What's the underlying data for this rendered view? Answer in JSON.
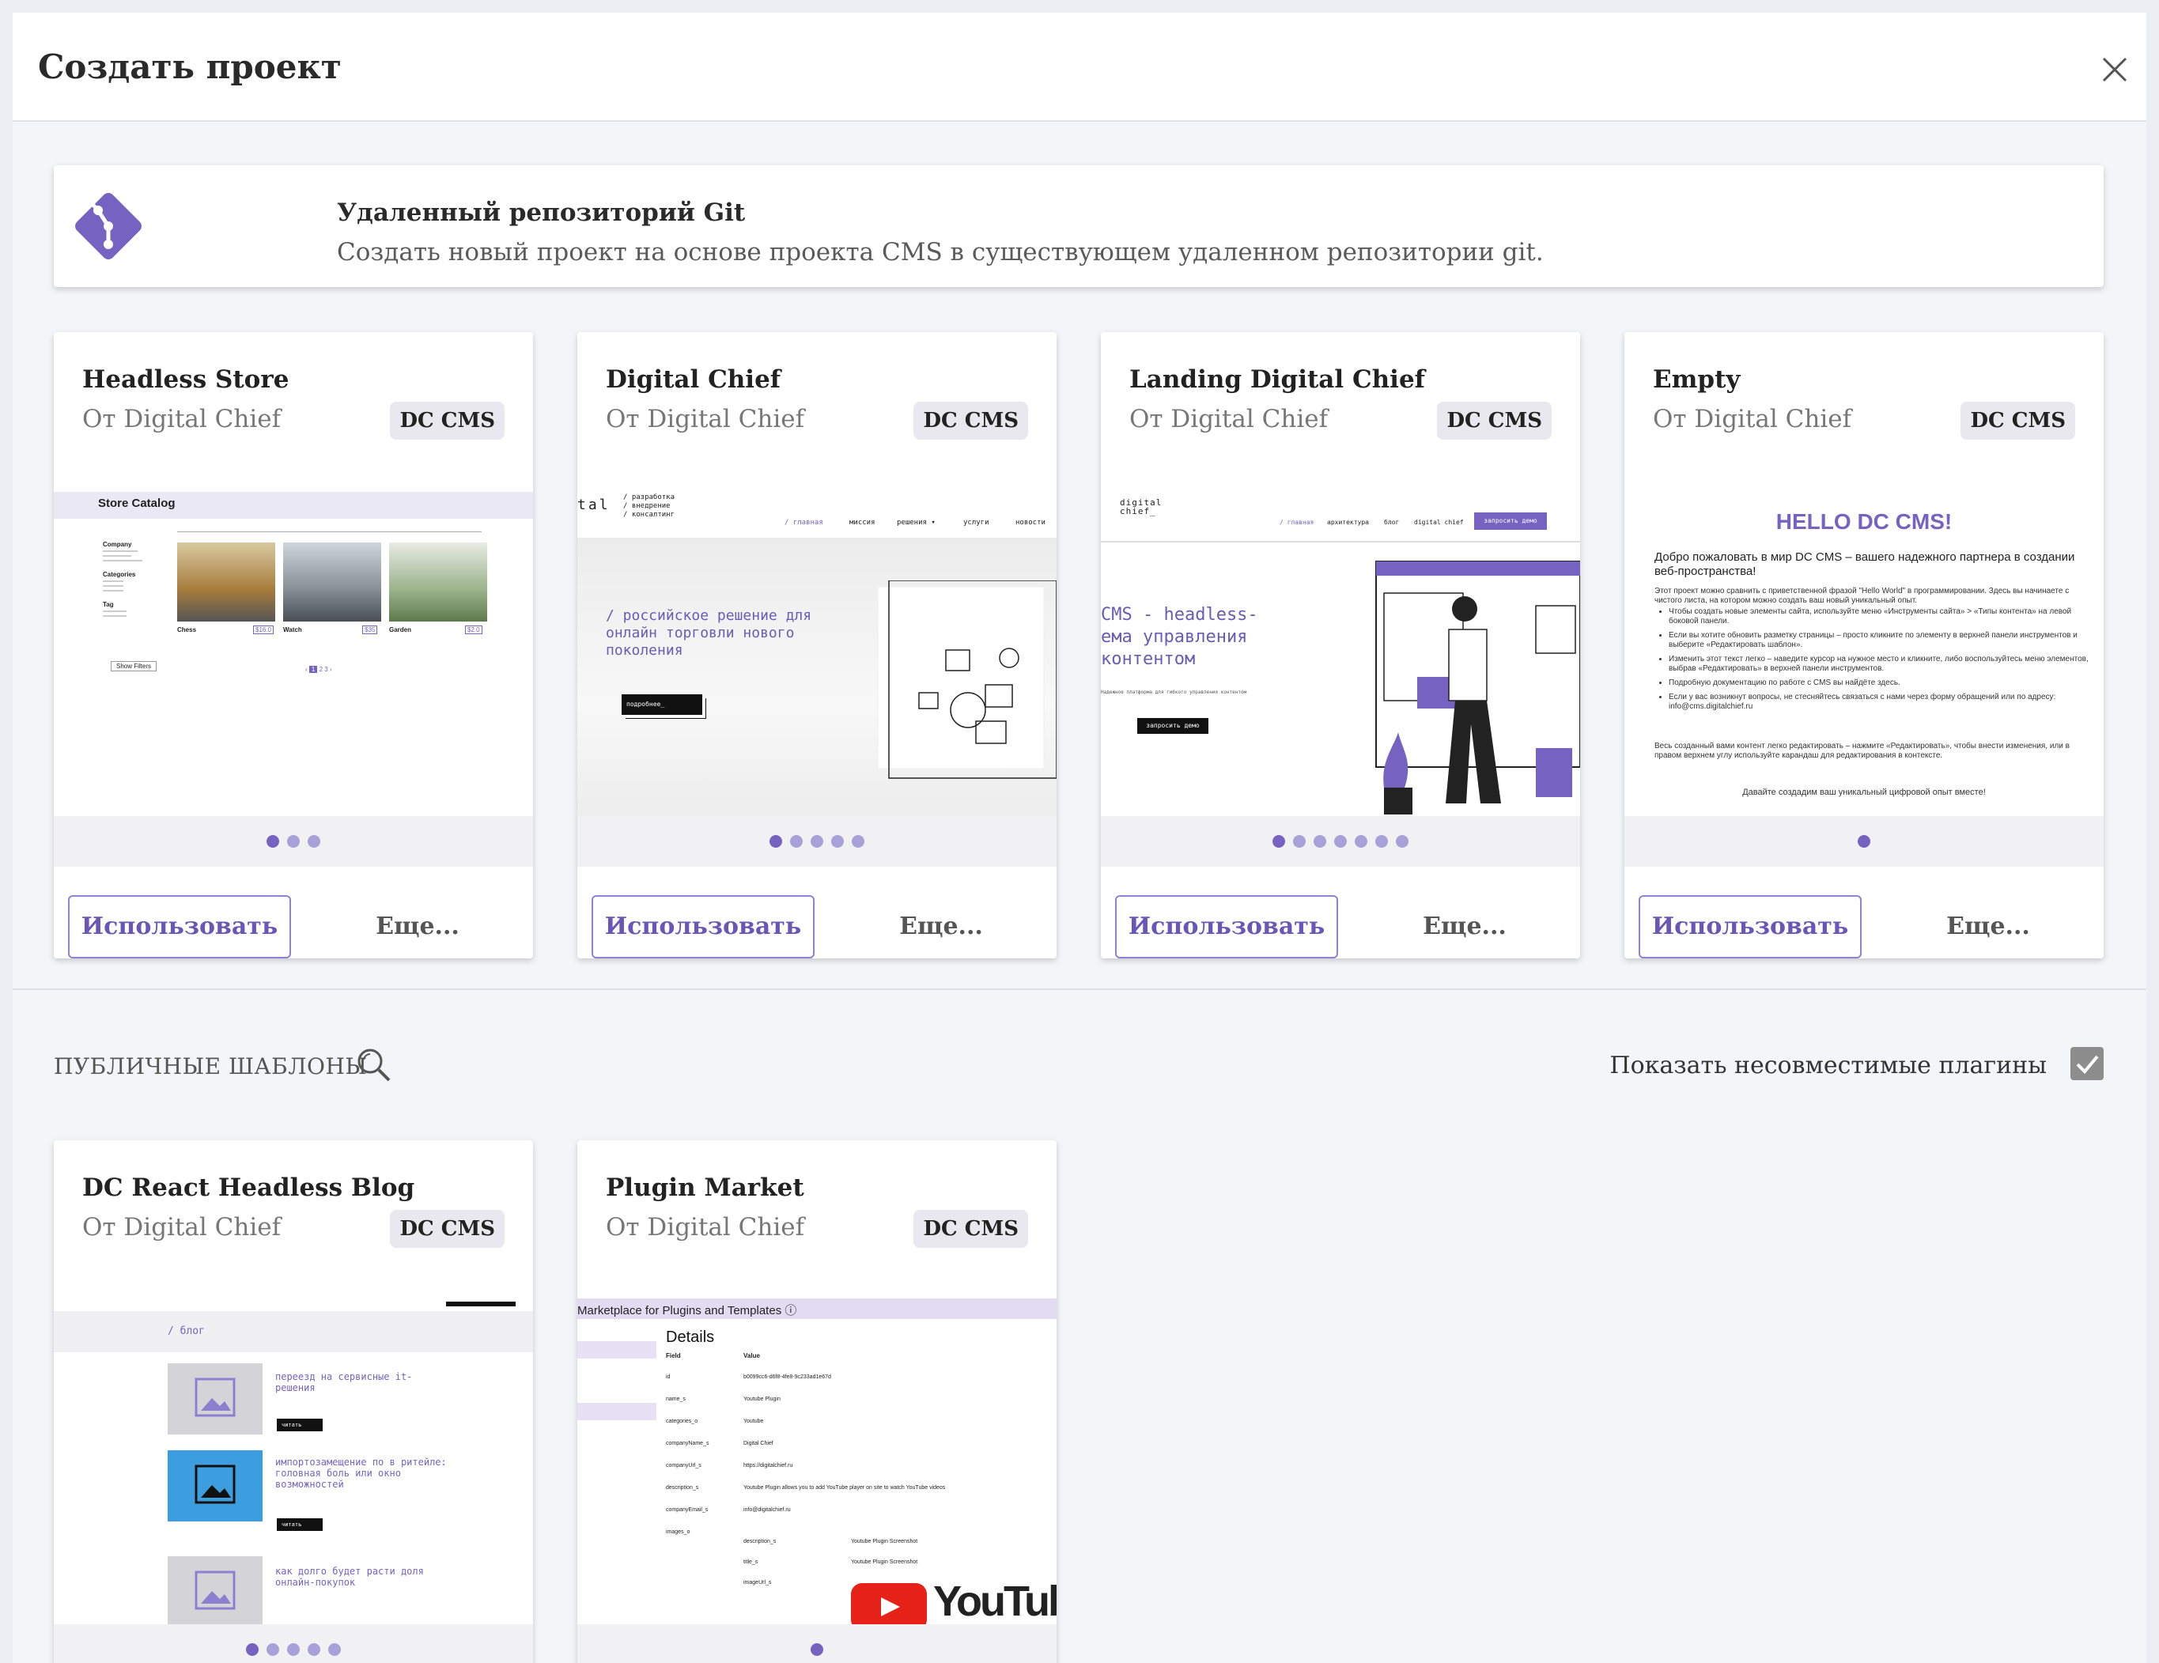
{
  "dialog": {
    "title": "Создать проект"
  },
  "git_option": {
    "title": "Удаленный репозиторий Git",
    "description": "Создать новый проект на основе проекта CMS в существующем удаленном репозитории git."
  },
  "common": {
    "use_label": "Использовать",
    "more_label": "Еще...",
    "badge": "DC CMS",
    "author": "От Digital Chief"
  },
  "templates": [
    {
      "title": "Headless Store",
      "preview": {
        "heading": "Store Catalog",
        "filters": [
          "Company",
          "Categories",
          "Tag"
        ],
        "products": [
          {
            "name": "Chess",
            "price": "$16.0"
          },
          {
            "name": "Watch",
            "price": "$35"
          },
          {
            "name": "Garden",
            "price": "$2.0"
          }
        ],
        "button": "Show Filters",
        "pages": [
          "‹",
          "1",
          "2",
          "3",
          "›"
        ]
      },
      "dots": 3
    },
    {
      "title": "Digital Chief",
      "preview": {
        "logo": "tal",
        "tagline": [
          "/ разработка",
          "/ внедрение",
          "/ консалтинг"
        ],
        "nav": [
          "/ главная",
          "миссия",
          "решения ▾",
          "услуги",
          "новости"
        ],
        "headline": [
          "/ российское решение для",
          "онлайн торговли нового",
          "поколения"
        ],
        "button": "подробнее_"
      },
      "dots": 5
    },
    {
      "title": "Landing Digital Chief",
      "preview": {
        "logo": "digital chief_",
        "nav": [
          "/ главная",
          "архитектура",
          "блог",
          "digital chief"
        ],
        "cta": "запросить демо",
        "headline": [
          "CMS - headless-",
          "ема управления",
          "контентом"
        ],
        "sub": "Надежное платформа для гибкого управления контентом",
        "button": "запросить демо"
      },
      "dots": 7
    },
    {
      "title": "Empty",
      "preview": {
        "heading": "HELLO DC CMS!",
        "intro": "Добро пожаловать в мир DC CMS – вашего надежного партнера в создании веб-пространства!",
        "para": "Этот проект можно сравнить с приветственной фразой \"Hello World\" в программировании. Здесь вы начинаете с чистого листа, на котором можно создать ваш новый уникальный опыт.",
        "bullets": [
          "Чтобы создать новые элементы сайта, используйте меню «Инструменты сайта» > «Типы контента» на левой боковой панели.",
          "Если вы хотите обновить разметку страницы – просто кликните по элементу в верхней панели инструментов и выберите «Редактировать шаблон».",
          "Изменить этот текст легко – наведите курсор на нужное место и кликните, либо воспользуйтесь меню элементов, выбрав «Редактировать» в верхней панели инструментов.",
          "Подробную документацию по работе с CMS вы найдёте здесь.",
          "Если у вас возникнут вопросы, не стесняйтесь связаться с нами через форму обращений или по адресу: info@cms.digitalchief.ru"
        ],
        "outro": "Весь созданный вами контент легко редактировать – нажмите «Редактировать», чтобы внести изменения, или в правом верхнем углу используйте карандаш для редактирования в контексте.",
        "footer": "Давайте создадим ваш уникальный цифровой опыт вместе!"
      },
      "dots": 1
    }
  ],
  "public_section": {
    "label": "ПУБЛИЧНЫЕ ШАБЛОНЫ",
    "toggle_label": "Показать несовместимые плагины",
    "toggle_checked": true
  },
  "public_templates": [
    {
      "title": "DC React Headless Blog",
      "preview": {
        "breadcrumb": "/ блог",
        "posts": [
          {
            "title": "переезд на сервисные it-решения",
            "button": "читать"
          },
          {
            "title": "импортозамещение по в ритейле: головная боль или окно возможностей",
            "button": "читать"
          },
          {
            "title": "как долго будет расти доля онлайн-покупок",
            "button": ""
          }
        ]
      },
      "dots": 5
    },
    {
      "title": "Plugin Market",
      "preview": {
        "header": "Marketplace for Plugins and Templates ⓘ",
        "details_title": "Details",
        "columns": [
          "Field",
          "Value"
        ],
        "rows": [
          [
            "id",
            "b0099cc6-d6f8-4fe8-9c233ad1e67d"
          ],
          [
            "name_s",
            "Youtube Plugin"
          ],
          [
            "categories_o",
            "Youtube"
          ],
          [
            "companyName_s",
            "Digital Chief"
          ],
          [
            "companyUrl_s",
            "https://digitalchief.ru"
          ],
          [
            "description_s",
            "Youtube Plugin allows you to add YouTube player on site to watch YouTube videos"
          ],
          [
            "companyEmail_s",
            "info@digitalchief.ru"
          ],
          [
            "images_o",
            ""
          ]
        ],
        "subrows": [
          [
            "description_s",
            "Youtube Plugin Screenshot"
          ],
          [
            "title_s",
            "Youtube Plugin Screenshot"
          ],
          [
            "imageUrl_s",
            ""
          ]
        ],
        "logo_text": "YouTub"
      },
      "dots": 1
    }
  ],
  "colors": {
    "accent": "#7563c1",
    "accent_light": "#a8a0d8",
    "badge_bg": "#e8e8ee"
  }
}
